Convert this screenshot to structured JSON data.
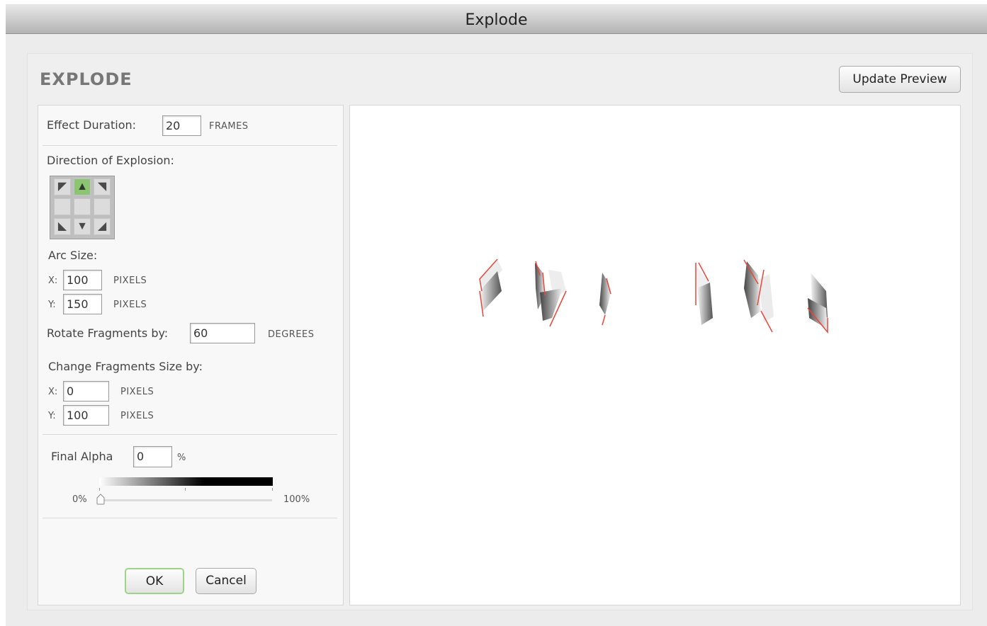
{
  "window": {
    "title": "Explode"
  },
  "header": {
    "title": "EXPLODE",
    "update_label": "Update Preview"
  },
  "effect_duration": {
    "label": "Effect Duration:",
    "value": "20",
    "unit": "FRAMES"
  },
  "direction": {
    "label": "Direction of Explosion:",
    "cells": [
      {
        "name": "direction-top-left",
        "glyph": "◤",
        "selected": false
      },
      {
        "name": "direction-top",
        "glyph": "▲",
        "selected": true
      },
      {
        "name": "direction-top-right",
        "glyph": "◥",
        "selected": false
      },
      {
        "name": "direction-left",
        "glyph": "",
        "selected": false
      },
      {
        "name": "direction-center",
        "glyph": "",
        "selected": false
      },
      {
        "name": "direction-right",
        "glyph": "",
        "selected": false
      },
      {
        "name": "direction-bottom-left",
        "glyph": "◣",
        "selected": false
      },
      {
        "name": "direction-bottom",
        "glyph": "▼",
        "selected": false
      },
      {
        "name": "direction-bottom-right",
        "glyph": "◢",
        "selected": false
      }
    ]
  },
  "arc_size": {
    "label": "Arc Size:",
    "x_label": "X:",
    "x_value": "100",
    "x_unit": "PIXELS",
    "y_label": "Y:",
    "y_value": "150",
    "y_unit": "PIXELS"
  },
  "rotate": {
    "label": "Rotate Fragments by:",
    "value": "60",
    "unit": "DEGREES"
  },
  "fragment_size": {
    "label": "Change Fragments Size by:",
    "x_label": "X:",
    "x_value": "0",
    "x_unit": "PIXELS",
    "y_label": "Y:",
    "y_value": "100",
    "y_unit": "PIXELS"
  },
  "final_alpha": {
    "label": "Final Alpha",
    "value": "0",
    "unit": "%",
    "min_label": "0%",
    "max_label": "100%",
    "slider_level": 0
  },
  "footer": {
    "ok_label": "OK",
    "cancel_label": "Cancel"
  },
  "colors": {
    "accent_green": "#8bc572",
    "fragment_edge": "#e8463a"
  }
}
